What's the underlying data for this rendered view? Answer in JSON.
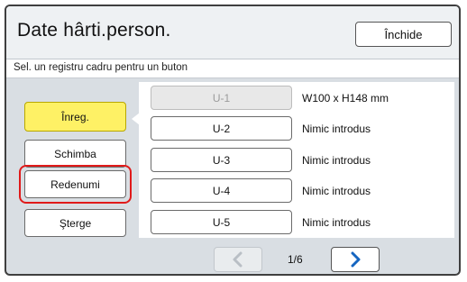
{
  "header": {
    "title": "Date hârti.person.",
    "close_label": "Închide"
  },
  "subtitle": "Sel. un registru cadru pentru un buton",
  "actions": [
    {
      "label": "Înreg.",
      "state": "active"
    },
    {
      "label": "Schimba",
      "state": "normal"
    },
    {
      "label": "Redenumi",
      "state": "selected"
    },
    {
      "label": "Şterge",
      "state": "normal"
    }
  ],
  "slots": [
    {
      "label": "U-1",
      "description": "W100 x H148 mm",
      "state": "disabled"
    },
    {
      "label": "U-2",
      "description": "Nimic introdus",
      "state": "normal"
    },
    {
      "label": "U-3",
      "description": "Nimic introdus",
      "state": "normal"
    },
    {
      "label": "U-4",
      "description": "Nimic introdus",
      "state": "normal"
    },
    {
      "label": "U-5",
      "description": "Nimic introdus",
      "state": "normal"
    }
  ],
  "pagination": {
    "indicator": "1/6",
    "prev_enabled": false,
    "next_enabled": true
  },
  "colors": {
    "active_button": "#fef165",
    "selection_outline": "#e01a1a",
    "next_arrow": "#1565c0",
    "disabled_arrow": "#b9bfc5"
  }
}
